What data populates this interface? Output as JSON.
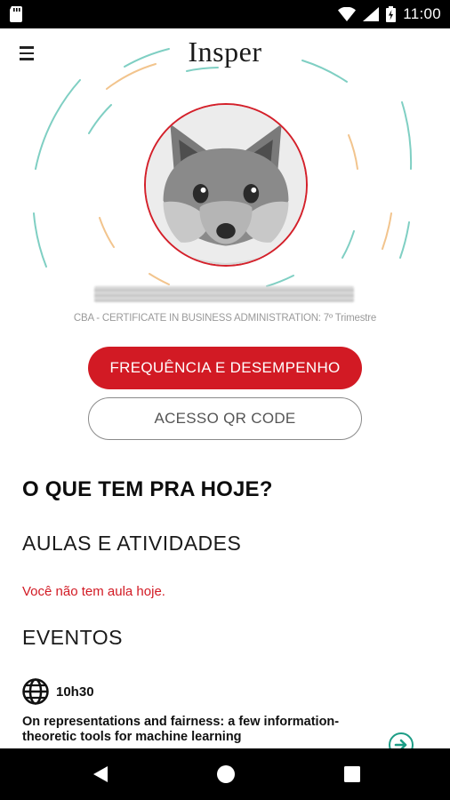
{
  "status_bar": {
    "time": "11:00"
  },
  "header": {
    "brand": "Insper"
  },
  "profile": {
    "program": "CBA - CERTIFICATE IN BUSINESS ADMINISTRATION: 7º Trimestre"
  },
  "buttons": {
    "primary": "FREQUÊNCIA E DESEMPENHO",
    "secondary": "ACESSO QR CODE"
  },
  "today": {
    "title": "O QUE TEM PRA HOJE?",
    "classes_title": "AULAS E ATIVIDADES",
    "no_class_message": "Você não tem aula hoje.",
    "events_title": "EVENTOS",
    "events": [
      {
        "time": "10h30",
        "title": "On representations and fairness: a few information-theoretic tools for machine learning"
      }
    ]
  },
  "colors": {
    "accent": "#d21a24",
    "event_arrow": "#1d9d86",
    "arc_teal": "#7fcfc3",
    "arc_orange": "#f2c48d"
  }
}
